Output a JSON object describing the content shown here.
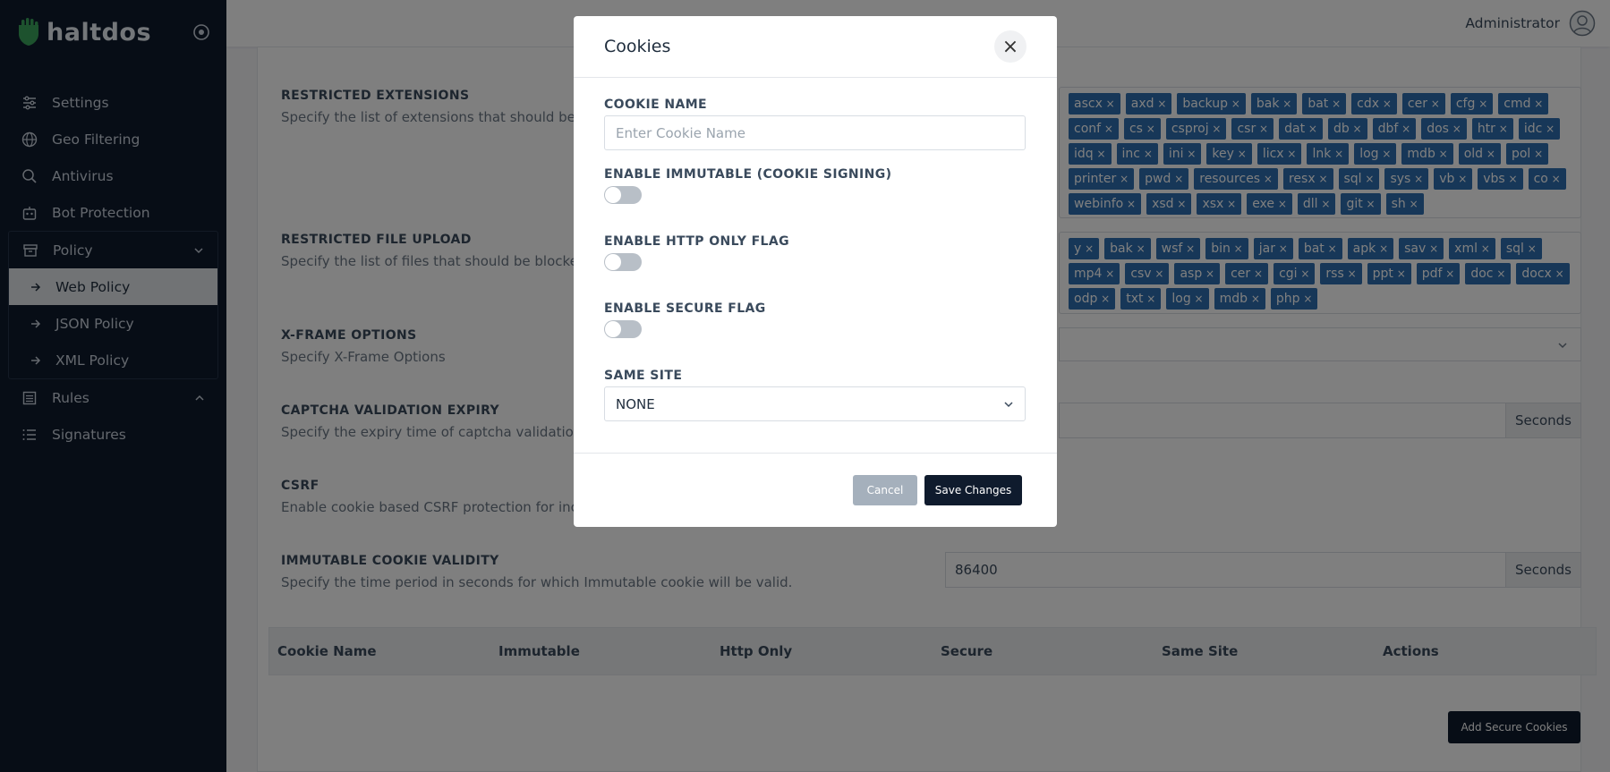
{
  "sidebar": {
    "brand": "haltdos",
    "items": [
      {
        "label": "Settings"
      },
      {
        "label": "Geo Filtering"
      },
      {
        "label": "Antivirus"
      },
      {
        "label": "Bot Protection"
      }
    ],
    "policy": {
      "label": "Policy",
      "subitems": [
        {
          "label": "Web Policy"
        },
        {
          "label": "JSON Policy"
        },
        {
          "label": "XML Policy"
        }
      ]
    },
    "rules": {
      "label": "Rules"
    },
    "signatures": {
      "label": "Signatures"
    }
  },
  "topbar": {
    "user": "Administrator"
  },
  "main": {
    "restricted_extensions": {
      "label": "RESTRICTED EXTENSIONS",
      "desc": "Specify the list of extensions that should be bloc",
      "tags": [
        "ascx",
        "axd",
        "backup",
        "bak",
        "bat",
        "cdx",
        "cer",
        "cfg",
        "cmd",
        "conf",
        "cs",
        "csproj",
        "csr",
        "dat",
        "db",
        "dbf",
        "dos",
        "htr",
        "idc",
        "idq",
        "inc",
        "ini",
        "key",
        "licx",
        "lnk",
        "log",
        "mdb",
        "old",
        "pol",
        "printer",
        "pwd",
        "resources",
        "resx",
        "sql",
        "sys",
        "vb",
        "vbs",
        "co",
        "webinfo",
        "xsd",
        "xsx",
        "exe",
        "dll",
        "git",
        "sh"
      ]
    },
    "restricted_upload": {
      "label": "RESTRICTED FILE UPLOAD",
      "desc": "Specify the list of files that should be blocked.",
      "tags": [
        "y",
        "bak",
        "wsf",
        "bin",
        "jar",
        "bat",
        "apk",
        "sav",
        "xml",
        "sql",
        "mp4",
        "csv",
        "asp",
        "cer",
        "cgi",
        "rss",
        "ppt",
        "pdf",
        "doc",
        "docx",
        "odp",
        "txt",
        "log",
        "mdb",
        "php"
      ]
    },
    "xframe": {
      "label": "X-FRAME OPTIONS",
      "desc": "Specify X-Frame Options"
    },
    "captcha": {
      "label": "CAPTCHA VALIDATION EXPIRY",
      "desc": "Specify the expiry time of captcha validation in s",
      "addon": "Seconds"
    },
    "csrf": {
      "label": "CSRF",
      "desc": "Enable cookie based CSRF protection for incomi"
    },
    "immutable_validity": {
      "label": "IMMUTABLE COOKIE VALIDITY",
      "desc": "Specify the time period in seconds for which Immutable cookie will be valid.",
      "value": "86400",
      "addon": "Seconds"
    },
    "table_headers": [
      "Cookie Name",
      "Immutable",
      "Http Only",
      "Secure",
      "Same Site",
      "Actions"
    ],
    "add_button": "Add Secure Cookies"
  },
  "modal": {
    "title": "Cookies",
    "close": "×",
    "cookie_name_label": "COOKIE NAME",
    "cookie_name_placeholder": "Enter Cookie Name",
    "immutable_label": "ENABLE IMMUTABLE (COOKIE SIGNING)",
    "http_only_label": "ENABLE HTTP ONLY FLAG",
    "secure_label": "ENABLE SECURE FLAG",
    "same_site_label": "SAME SITE",
    "same_site_value": "NONE",
    "toggles": {
      "immutable": false,
      "http_only": false,
      "secure": false
    },
    "cancel": "Cancel",
    "save": "Save Changes"
  }
}
